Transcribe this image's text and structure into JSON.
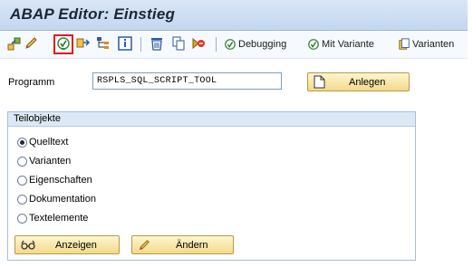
{
  "window": {
    "title": "ABAP Editor: Einstieg"
  },
  "toolbar": {
    "icons": [
      "where-used-icon",
      "change-pencil-icon",
      "execute-icon",
      "other-object-icon",
      "hierarchy-icon",
      "info-icon",
      "delete-icon",
      "copy-icon",
      "debug-settings-icon"
    ],
    "debugging_label": "Debugging",
    "mit_variante_label": "Mit Variante",
    "varianten_label": "Varianten",
    "highlighted_icon": "execute-icon",
    "highlight_color": "#e11b1b"
  },
  "program": {
    "label": "Programm",
    "value": "RSPLS_SQL_SCRIPT_TOOL",
    "create_label": "Anlegen"
  },
  "subobjects": {
    "title": "Teilobjekte",
    "options": [
      {
        "label": "Quelltext",
        "selected": true
      },
      {
        "label": "Varianten",
        "selected": false
      },
      {
        "label": "Eigenschaften",
        "selected": false
      },
      {
        "label": "Dokumentation",
        "selected": false
      },
      {
        "label": "Textelemente",
        "selected": false
      }
    ],
    "display_label": "Anzeigen",
    "change_label": "Ändern"
  },
  "colors": {
    "title_bg": "#c3d7ef",
    "button_bg": "#f3d98a",
    "group_header_bg": "#dde8f6"
  }
}
